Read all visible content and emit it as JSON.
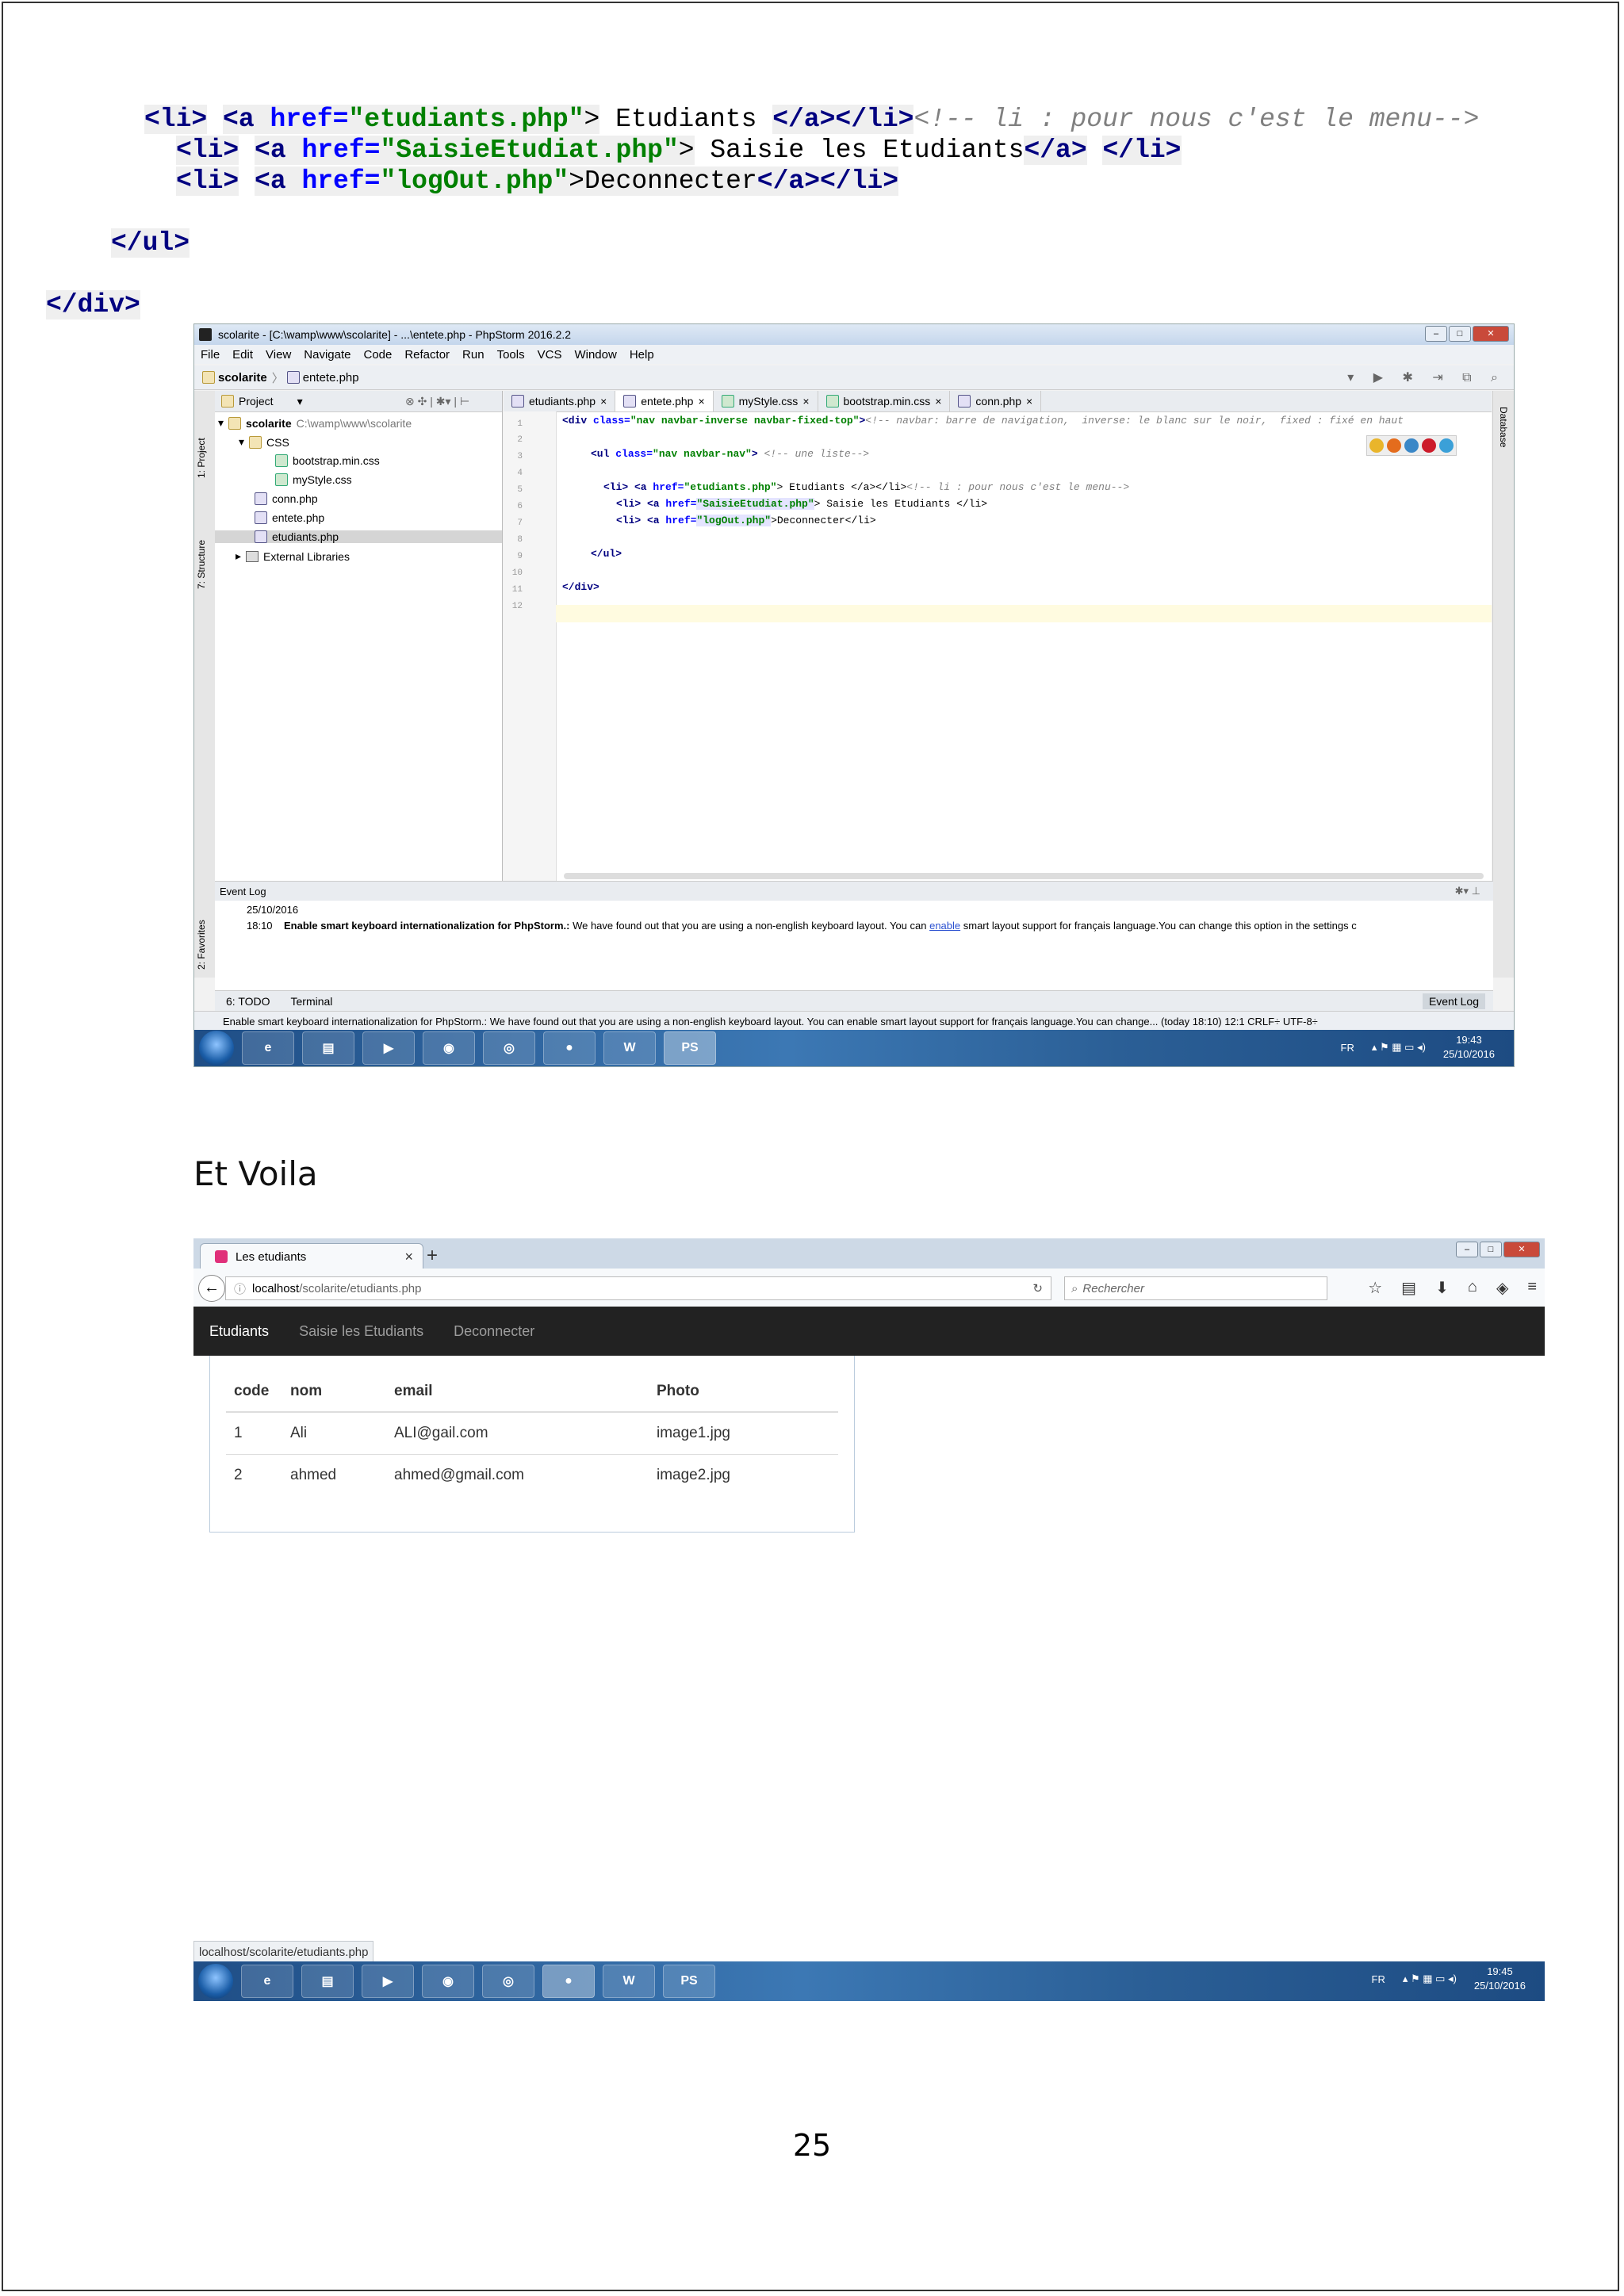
{
  "code_snippet": {
    "line1": {
      "li_open": "<li>",
      "a_open": "<a",
      "href_attr": "href=",
      "href_val": "\"etudiants.php\"",
      "gt": ">",
      "text": " Etudiants ",
      "a_close": "</a>",
      "li_close": "</li>",
      "comment": "<!-- li : pour nous c'est le menu-->"
    },
    "line2": {
      "li_open": "<li>",
      "a_open": "<a",
      "href_attr": "href=",
      "href_val": "\"SaisieEtudiat.php\"",
      "gt": ">",
      "text": " Saisie les Etudiants",
      "a_close": "</a>",
      "li_close": "</li>"
    },
    "line3": {
      "li_open": "<li>",
      "a_open": "<a",
      "href_attr": "href=",
      "href_val": "\"logOut.php\"",
      "gt": ">",
      "text": "Deconnecter",
      "a_close": "</a>",
      "li_close": "</li>"
    },
    "ul_close": "</ul>",
    "div_close": "</div>"
  },
  "ide": {
    "title": "scolarite - [C:\\wamp\\www\\scolarite] - ...\\entete.php - PhpStorm 2016.2.2",
    "menu": [
      "File",
      "Edit",
      "View",
      "Navigate",
      "Code",
      "Refactor",
      "Run",
      "Tools",
      "VCS",
      "Window",
      "Help"
    ],
    "breadcrumb": [
      "scolarite",
      "entete.php"
    ],
    "project_panel_label": "Project",
    "tree": [
      {
        "label": "scolarite",
        "path": "C:\\wamp\\www\\scolarite"
      },
      {
        "label": "CSS"
      },
      {
        "label": "bootstrap.min.css"
      },
      {
        "label": "myStyle.css"
      },
      {
        "label": "conn.php"
      },
      {
        "label": "entete.php"
      },
      {
        "label": "etudiants.php"
      },
      {
        "label": "External Libraries"
      }
    ],
    "tabs": [
      "etudiants.php",
      "entete.php",
      "myStyle.css",
      "bootstrap.min.css",
      "conn.php"
    ],
    "line_numbers": [
      "1",
      "2",
      "3",
      "4",
      "5",
      "6",
      "7",
      "8",
      "9",
      "10",
      "11",
      "12"
    ],
    "code": {
      "l1_tag": "<div ",
      "l1_attr": "class=",
      "l1_str": "\"nav navbar-inverse navbar-fixed-top\"",
      "l1_gt": ">",
      "l1_cm": "<!-- navbar: barre de navigation,  inverse: le blanc sur le noir,  fixed : fixé en haut",
      "l3_tag": "<ul ",
      "l3_attr": "class=",
      "l3_str": "\"nav navbar-nav\"",
      "l3_gt": ">",
      "l3_cm": " <!-- une liste-->",
      "l5_pre": "<li> <a ",
      "l5_attr": "href=",
      "l5_str": "\"etudiants.php\"",
      "l5_txt": "> Etudiants </a></li>",
      "l5_cm": "<!-- li : pour nous c'est le menu-->",
      "l6_pre": "<li> <a ",
      "l6_attr": "href=",
      "l6_str": "\"SaisieEtudiat.php\"",
      "l6_txt": "> Saisie les Etudiants </li>",
      "l7_pre": "<li> <a ",
      "l7_attr": "href=",
      "l7_str": "\"logOut.php\"",
      "l7_txt": ">Deconnecter</li>",
      "l9": "</ul>",
      "l11": "</div>"
    },
    "left_strip": [
      "1: Project",
      "7: Structure",
      "2: Favorites"
    ],
    "right_strip": "Database",
    "event_log": {
      "title": "Event Log",
      "date": "25/10/2016",
      "time": "18:10",
      "bold": "Enable smart keyboard internationalization for PhpStorm.:",
      "msg1": " We have found out that you are using a non-english keyboard layout. You can ",
      "link": "enable",
      "msg2": " smart layout support for français language.You can change this option in the settings c"
    },
    "tools": [
      "6: TODO",
      "Terminal",
      "Event Log"
    ],
    "status": "Enable smart keyboard internationalization for PhpStorm.: We have found out that you are using a non-english keyboard layout. You can enable smart layout support for français language.You can change... (today 18:10)   12:1   CRLF÷   UTF-8÷",
    "taskbar": {
      "lang": "FR",
      "time": "19:43",
      "date": "25/10/2016"
    }
  },
  "caption": "Et Voila",
  "browser": {
    "tab_title": "Les etudiants",
    "url_host": "localhost",
    "url_path": "/scolarite/etudiants.php",
    "search_placeholder": "Rechercher",
    "nav": [
      "Etudiants",
      "Saisie les Etudiants",
      "Deconnecter"
    ],
    "table": {
      "headers": [
        "code",
        "nom",
        "email",
        "Photo"
      ],
      "rows": [
        [
          "1",
          "Ali",
          "ALI@gail.com",
          "image1.jpg"
        ],
        [
          "2",
          "ahmed",
          "ahmed@gmail.com",
          "image2.jpg"
        ]
      ]
    }
  },
  "status_url": "localhost/scolarite/etudiants.php",
  "taskbar2": {
    "lang": "FR",
    "time": "19:45",
    "date": "25/10/2016"
  },
  "page_number": "25"
}
